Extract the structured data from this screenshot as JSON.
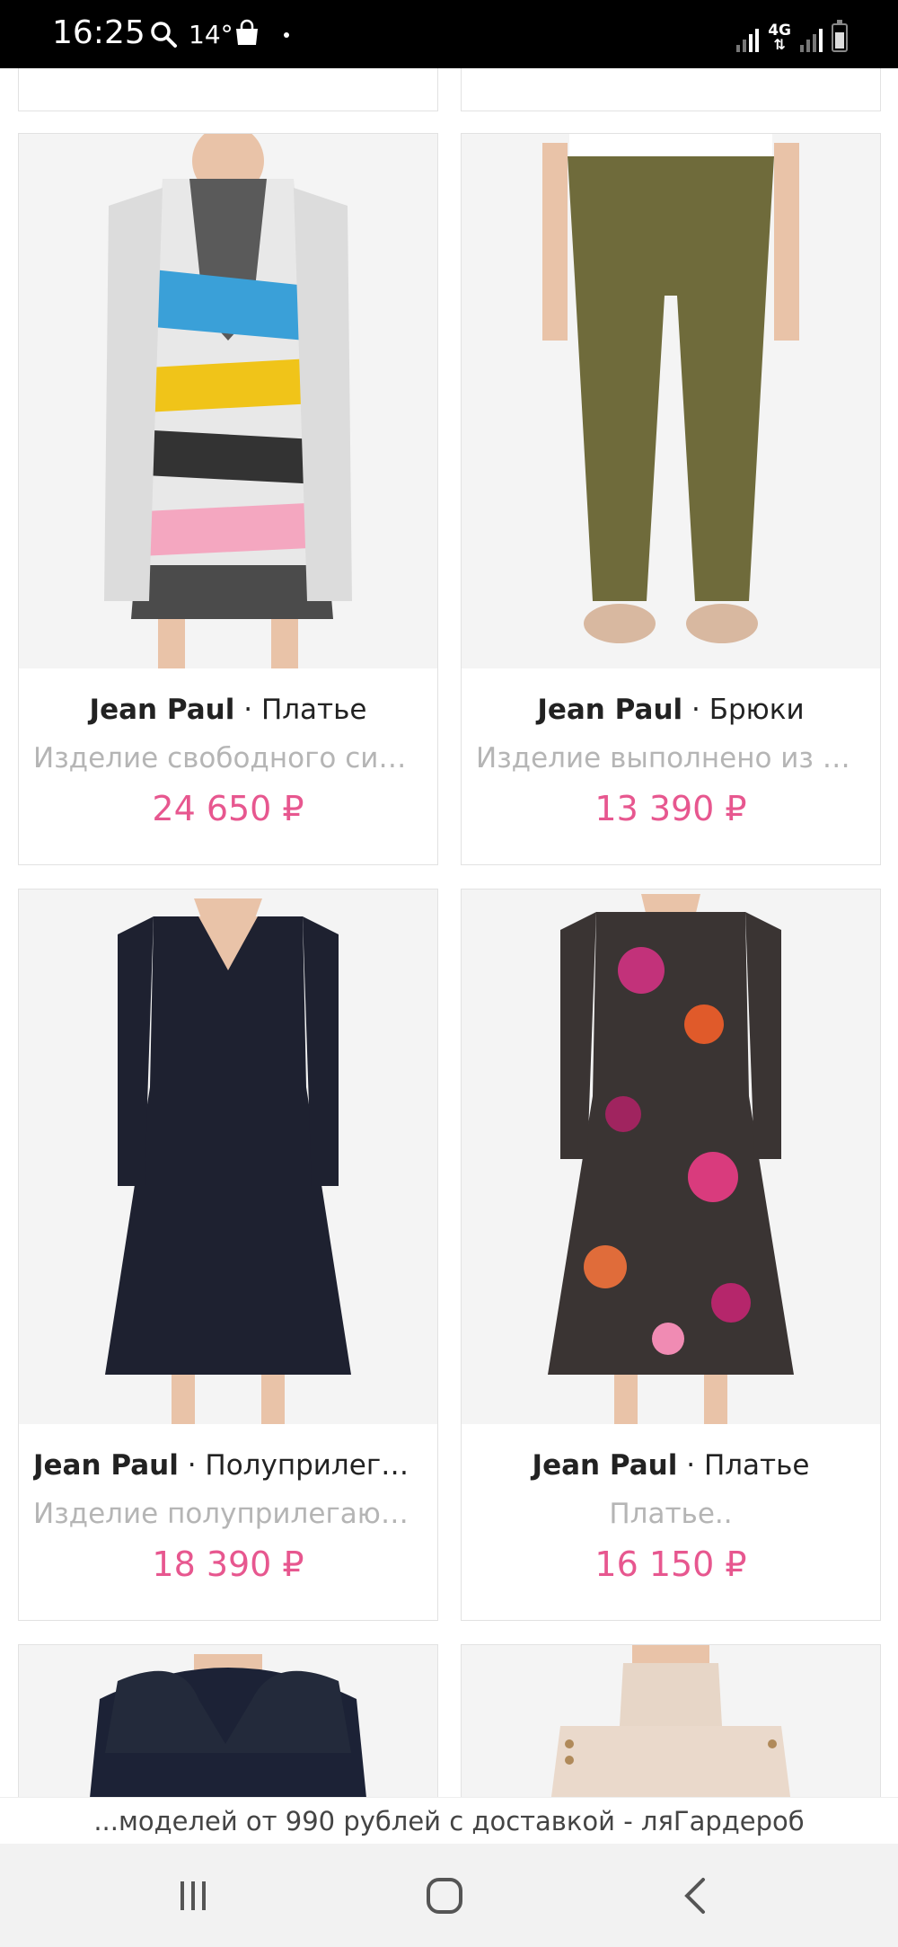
{
  "status_bar": {
    "time": "16:25",
    "temperature": "14°",
    "network": "4G"
  },
  "products": [
    {
      "brand": "Jean Paul",
      "separator": " · ",
      "type": "Платье",
      "description": "Изделие свободного силуэта",
      "price": "24 650 ₽",
      "image_icon": "floral-print-dress-photo"
    },
    {
      "brand": "Jean Paul",
      "separator": " · ",
      "type": "Брюки",
      "description": "Изделие выполнено из тонкой ткани",
      "price": "13 390 ₽",
      "image_icon": "olive-trousers-photo"
    },
    {
      "brand": "Jean Paul",
      "separator": " · ",
      "type": "Полуприлегающее платье",
      "description": "Изделие полуприлегающего силуэта",
      "price": "18 390 ₽",
      "image_icon": "black-dress-photo"
    },
    {
      "brand": "Jean Paul",
      "separator": " · ",
      "type": "Платье",
      "description": "Платье..",
      "price": "16 150 ₽",
      "image_icon": "dark-floral-dress-photo"
    }
  ],
  "url_bar": {
    "text": "...моделей от 990 рублей с доставкой - ляГардероб"
  },
  "colors": {
    "price": "#e7578f",
    "description": "#b5b5b5",
    "title": "#222222"
  }
}
